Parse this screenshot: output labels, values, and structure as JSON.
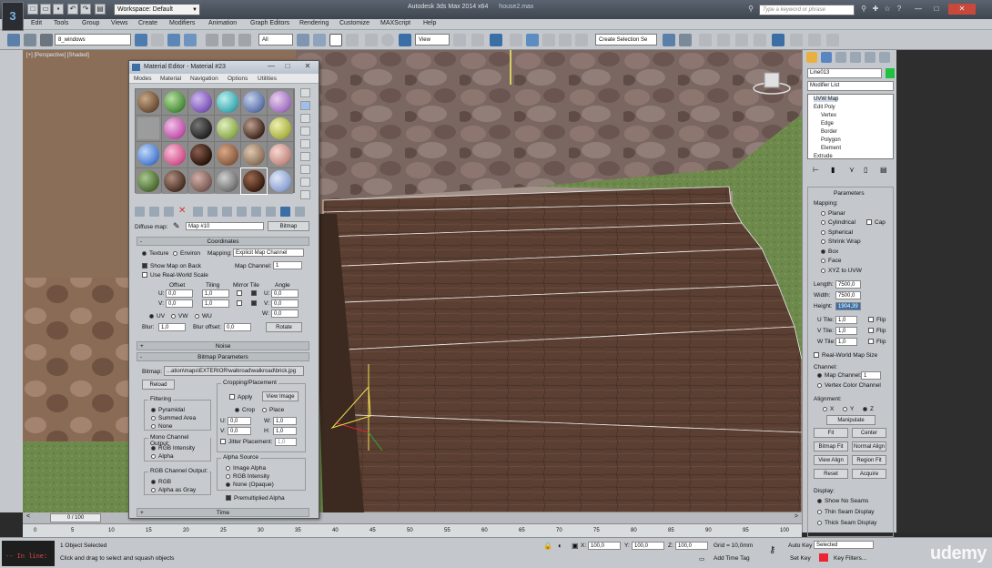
{
  "titlebar": {
    "workspace": "Workspace: Default",
    "title": "Autodesk 3ds Max  2014 x64",
    "filename": "house2.max",
    "search_placeholder": "Type a keyword or phrase"
  },
  "menu": [
    "Edit",
    "Tools",
    "Group",
    "Views",
    "Create",
    "Modifiers",
    "Animation",
    "Graph Editors",
    "Rendering",
    "Customize",
    "MAXScript",
    "Help"
  ],
  "toolbar": {
    "selection_set": "8_windows",
    "filter": "All",
    "ref_coord": "View",
    "named_selection": "Create Selection Se"
  },
  "viewport": {
    "label": "[+] [Perspective] [Shaded]"
  },
  "material_editor": {
    "title": "Material Editor - Material #23",
    "menu": [
      "Modes",
      "Material",
      "Navigation",
      "Options",
      "Utilities"
    ],
    "map_label": "Diffuse map:",
    "map_name": "Map #10",
    "map_type": "Bitmap",
    "coordinates": {
      "header": "Coordinates",
      "texture": "Texture",
      "environ": "Environ",
      "mapping_label": "Mapping:",
      "mapping_value": "Explicit Map Channel",
      "show_map_on_back": "Show Map on Back",
      "map_channel_label": "Map Channel:",
      "map_channel_value": "1",
      "use_real_world": "Use Real-World Scale",
      "col_offset": "Offset",
      "col_tiling": "Tiling",
      "col_mirror_tile": "Mirror Tile",
      "col_angle": "Angle",
      "u_label": "U:",
      "v_label": "V:",
      "w_label": "W:",
      "u_offset": "0,0",
      "v_offset": "0,0",
      "u_tiling": "1,0",
      "v_tiling": "1,0",
      "u_angle": "0,0",
      "v_angle": "0,0",
      "w_angle": "0,0",
      "uv": "UV",
      "vw": "VW",
      "wu": "WU",
      "blur_label": "Blur:",
      "blur_value": "1,0",
      "blur_offset_label": "Blur offset:",
      "blur_offset_value": "0,0",
      "rotate": "Rotate"
    },
    "noise_header": "Noise",
    "bitmap_params": {
      "header": "Bitmap Parameters",
      "bitmap_label": "Bitmap:",
      "bitmap_path": "...ation\\maps\\EXTERIOR\\walkroad\\walkroad\\brick.jpg",
      "reload": "Reload",
      "cropping_title": "Cropping/Placement",
      "apply": "Apply",
      "view_image": "View Image",
      "crop": "Crop",
      "place": "Place",
      "u_label": "U:",
      "v_label": "V:",
      "w_label": "W:",
      "h_label": "H:",
      "u_val": "0,0",
      "v_val": "0,0",
      "w_val": "1,0",
      "h_val": "1,0",
      "jitter_label": "Jitter Placement:",
      "jitter_val": "1,0",
      "filtering_title": "Filtering",
      "pyramidal": "Pyramidal",
      "summed_area": "Summed Area",
      "none": "None",
      "mono_title": "Mono Channel Output:",
      "rgb_intensity": "RGB Intensity",
      "alpha": "Alpha",
      "rgb_title": "RGB Channel Output:",
      "rgb": "RGB",
      "alpha_as_gray": "Alpha as Gray",
      "alpha_source_title": "Alpha Source",
      "image_alpha": "Image Alpha",
      "rgb_intensity2": "RGB Intensity",
      "none_opaque": "None (Opaque)",
      "premultiplied": "Premultiplied Alpha"
    },
    "time_header": "Time"
  },
  "command_panel": {
    "object_name": "Line013",
    "modifier_list": "Modifier List",
    "stack": [
      "UVW Map",
      "Edit Poly",
      "Vertex",
      "Edge",
      "Border",
      "Polygon",
      "Element",
      "Extrude"
    ],
    "params_header": "Parameters",
    "mapping_title": "Mapping:",
    "mapping_options": [
      "Planar",
      "Cylindrical",
      "Spherical",
      "Shrink Wrap",
      "Box",
      "Face",
      "XYZ to UVW"
    ],
    "cap": "Cap",
    "length_label": "Length:",
    "length_value": "7500,0",
    "width_label": "Width:",
    "width_value": "7500,0",
    "height_label": "Height:",
    "height_value": "1904,39",
    "utile_label": "U Tile:",
    "utile_value": "1,0",
    "vtile_label": "V Tile:",
    "vtile_value": "1,0",
    "wtile_label": "W Tile:",
    "wtile_value": "1,0",
    "flip": "Flip",
    "real_world": "Real-World Map Size",
    "channel_title": "Channel:",
    "map_channel": "Map Channel:",
    "map_channel_value": "1",
    "vertex_color_channel": "Vertex Color Channel",
    "alignment_title": "Alignment:",
    "x": "X",
    "y": "Y",
    "z": "Z",
    "manipulate": "Manipulate",
    "fit": "Fit",
    "center": "Center",
    "bitmap_fit": "Bitmap Fit",
    "normal_align": "Normal Align",
    "view_align": "View Align",
    "region_fit": "Region Fit",
    "reset": "Reset",
    "acquire": "Acquire",
    "display_title": "Display:",
    "show_no_seams": "Show No Seams",
    "thin_seam": "Thin Seam Display",
    "thick_seam": "Thick Seam Display"
  },
  "timeline": {
    "frame_counter": "0 / 100",
    "ticks": [
      "0",
      "5",
      "10",
      "15",
      "20",
      "25",
      "30",
      "35",
      "40",
      "45",
      "50",
      "55",
      "60",
      "65",
      "70",
      "75",
      "80",
      "85",
      "90",
      "95",
      "100"
    ]
  },
  "status": {
    "maxscript_prompt": "-- In line:",
    "selection": "1 Object Selected",
    "prompt": "Click and drag to select and squash objects",
    "x_label": "X:",
    "x_value": "100,0",
    "y_label": "Y:",
    "y_value": "100,0",
    "z_label": "Z:",
    "z_value": "100,0",
    "grid": "Grid = 10,0mm",
    "add_time_tag": "Add Time Tag",
    "auto_key": "Auto Key",
    "set_key": "Set Key",
    "selected": "Selected",
    "key_filters": "Key Filters...",
    "watermark": "udemy"
  },
  "colors": {
    "grass": "#6d8a4c",
    "wood": "#5a3f32",
    "stone": "#7b6761",
    "highlight": "#3a6ea5"
  }
}
